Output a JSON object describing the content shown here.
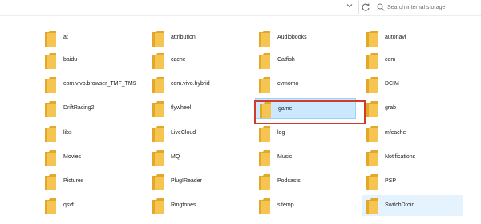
{
  "search": {
    "placeholder": "Search internal storage"
  },
  "toolbar": {
    "dropdown_icon": "chevron-down-icon",
    "refresh_icon": "refresh-icon",
    "search_icon": "search-icon"
  },
  "colors": {
    "folder": "#f5c451",
    "folder_dark": "#e3a82a",
    "selection": "#cce8ff",
    "highlight": "#d23a2a"
  },
  "folders": [
    {
      "label": "at"
    },
    {
      "label": "attribution"
    },
    {
      "label": "Audiobooks"
    },
    {
      "label": "autonavi"
    },
    {
      "label": "baidu"
    },
    {
      "label": "cache"
    },
    {
      "label": "Catfish"
    },
    {
      "label": "com"
    },
    {
      "label": "com.vivo.browser_TMF_TMS"
    },
    {
      "label": "com.vivo.hybrid"
    },
    {
      "label": "cvmomo"
    },
    {
      "label": "DCIM"
    },
    {
      "label": "DriftRacing2"
    },
    {
      "label": "flywheel"
    },
    {
      "label": "game"
    },
    {
      "label": "grab"
    },
    {
      "label": "libs"
    },
    {
      "label": "LiveCloud"
    },
    {
      "label": "log"
    },
    {
      "label": "mfcache"
    },
    {
      "label": "Movies"
    },
    {
      "label": "MQ"
    },
    {
      "label": "Music"
    },
    {
      "label": "Notifications"
    },
    {
      "label": "Pictures"
    },
    {
      "label": "PlugIReader"
    },
    {
      "label": "Podcasts"
    },
    {
      "label": "PSP"
    },
    {
      "label": "qsvf"
    },
    {
      "label": "Ringtones"
    },
    {
      "label": "sitemp"
    },
    {
      "label": "SwitchDroid"
    }
  ]
}
